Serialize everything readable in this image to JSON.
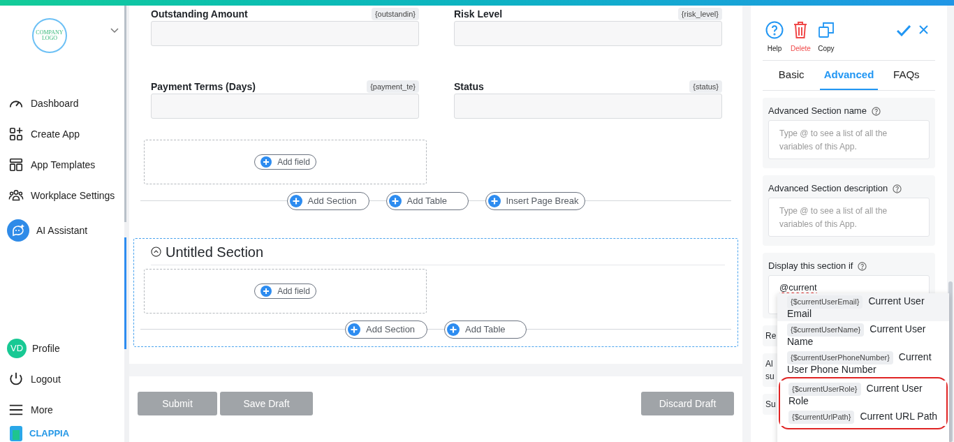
{
  "sidebar": {
    "logo": "COMPANY LOGO",
    "nav": [
      {
        "label": "Dashboard",
        "kind": "gauge"
      },
      {
        "label": "Create App",
        "kind": "apps"
      },
      {
        "label": "App Templates",
        "kind": "layout"
      },
      {
        "label": "Workplace Settings",
        "kind": "people"
      },
      {
        "label": "AI Assistant",
        "kind": "ai"
      }
    ],
    "bottom": [
      {
        "label": "Profile",
        "kind": "avatar",
        "initials": "VD"
      },
      {
        "label": "Logout",
        "kind": "power"
      },
      {
        "label": "More",
        "kind": "menu"
      }
    ],
    "brand": "CLAPPIA"
  },
  "form": {
    "fields": [
      {
        "label": "Outstanding Amount",
        "tag": "{outstandin}"
      },
      {
        "label": "Risk Level",
        "tag": "{risk_level}"
      },
      {
        "label": "Payment Terms (Days)",
        "tag": "{payment_te}"
      },
      {
        "label": "Status",
        "tag": "{status}"
      }
    ],
    "add_field": "Add field",
    "actions": [
      "Add Section",
      "Add Table",
      "Insert Page Break"
    ],
    "section": {
      "title": "Untitled Section",
      "expanded": true,
      "selected": true,
      "add_field": "Add field",
      "actions": [
        "Add Section",
        "Add Table"
      ]
    },
    "footer": {
      "left": [
        "Submit",
        "Save Draft"
      ],
      "right": "Discard Draft"
    }
  },
  "panel": {
    "tools": [
      {
        "label": "Help",
        "kind": "help"
      },
      {
        "label": "Delete",
        "kind": "delete"
      },
      {
        "label": "Copy",
        "kind": "copy"
      }
    ],
    "tabs": [
      {
        "label": "Basic",
        "selected": false
      },
      {
        "label": "Advanced",
        "selected": true
      },
      {
        "label": "FAQs",
        "selected": false
      }
    ],
    "cards": [
      {
        "label": "Advanced Section name",
        "placeholder": "Type @ to see a list of all the variables of this App."
      },
      {
        "label": "Advanced Section description",
        "placeholder": "Type @ to see a list of all the variables of this App."
      },
      {
        "label": "Display this section if",
        "value": "@current"
      }
    ],
    "hidden_cards": [
      [
        "Re"
      ],
      [
        "Al",
        "su"
      ],
      [
        "Su"
      ]
    ],
    "suggestions": [
      {
        "tag": "{$currentUserEmail}",
        "name": "Current User Email",
        "highlighted": true,
        "circled": false
      },
      {
        "tag": "{$currentUserName}",
        "name": "Current User Name",
        "highlighted": false,
        "circled": false
      },
      {
        "tag": "{$currentUserPhoneNumber}",
        "name": "Current User Phone Number",
        "highlighted": false,
        "circled": false
      },
      {
        "tag": "{$currentUserRole}",
        "name": "Current User Role",
        "highlighted": false,
        "circled": true
      },
      {
        "tag": "{$currentUrlPath}",
        "name": "Current URL Path",
        "highlighted": false,
        "circled": true
      }
    ]
  }
}
